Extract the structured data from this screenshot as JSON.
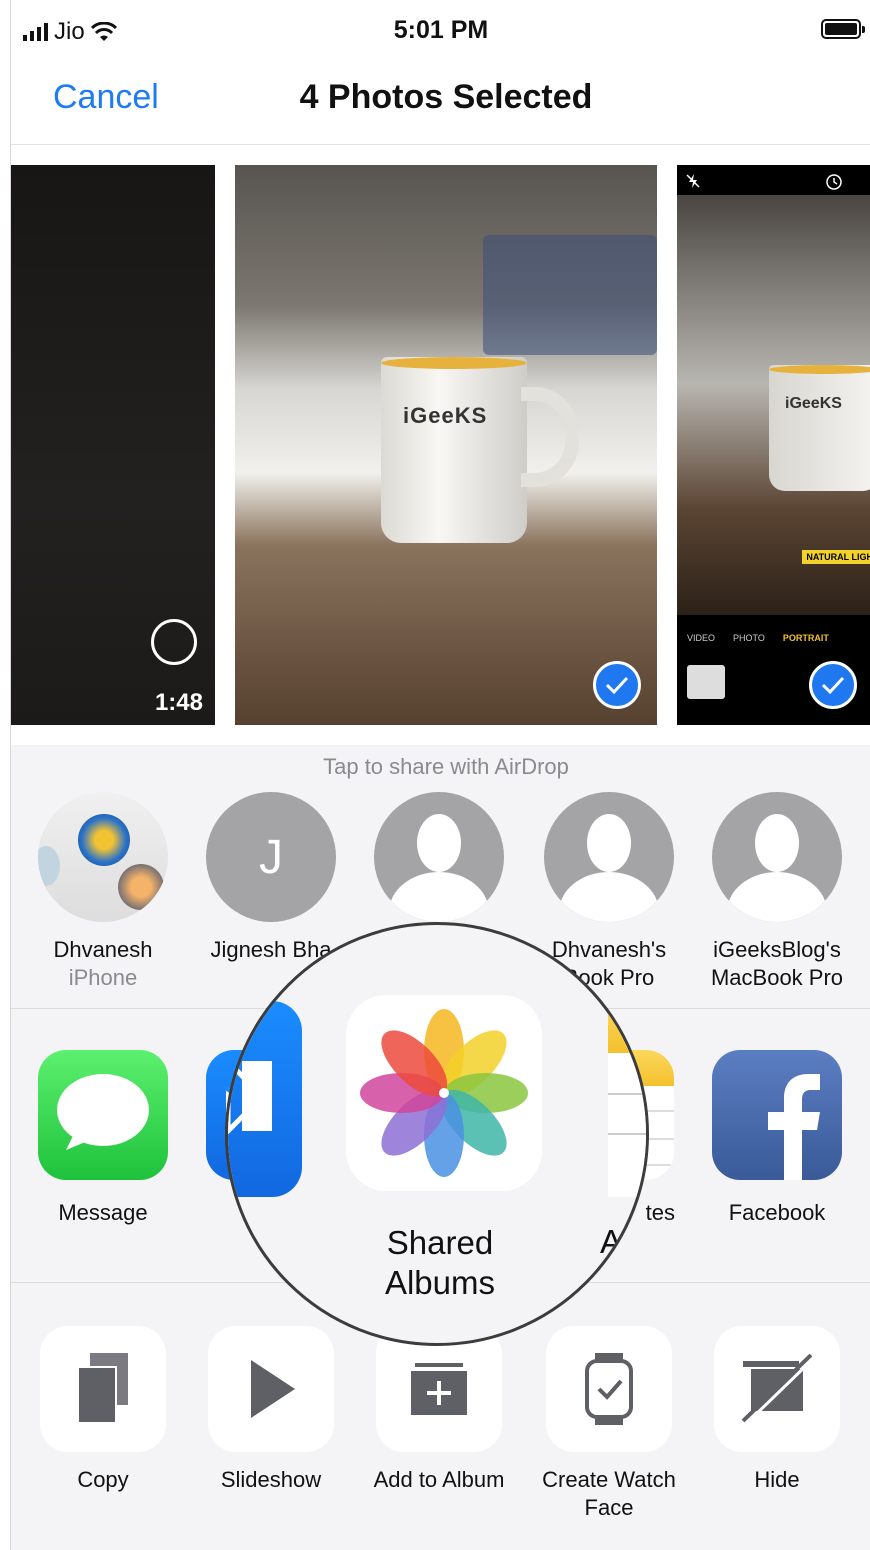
{
  "status": {
    "carrier": "Jio",
    "time": "5:01 PM"
  },
  "nav": {
    "cancel": "Cancel",
    "title": "4 Photos Selected"
  },
  "photos": [
    {
      "duration": "1:48",
      "selected": false
    },
    {
      "mug_text": "iGeeKS",
      "selected": true
    },
    {
      "mug_text": "iGeeKS",
      "banner": "NATURAL LIGH",
      "modes": [
        "VIDEO",
        "PHOTO",
        "PORTRAIT"
      ],
      "selected": true
    }
  ],
  "airdrop": {
    "hint": "Tap to share with AirDrop",
    "contacts": [
      {
        "name": "Dhvanesh",
        "sub": "iPhone"
      },
      {
        "initial": "J",
        "name": "Jignesh Bha"
      },
      {
        "name": "",
        "sub": ""
      },
      {
        "name": "Dhvanesh's",
        "sub": "Book Pro"
      },
      {
        "name": "iGeeksBlog's",
        "sub": "MacBook Pro"
      }
    ]
  },
  "apps": [
    {
      "label": "Message",
      "icon": "message-icon"
    },
    {
      "label": "",
      "icon": "mail-icon"
    },
    {
      "label": "Shared Albums",
      "icon": "photos-icon"
    },
    {
      "label": "tes",
      "icon": "notes-icon"
    },
    {
      "label": "Facebook",
      "icon": "facebook-icon"
    }
  ],
  "magnifier": {
    "label_line1": "Shared",
    "label_line2": "Albums",
    "partial": "Ad"
  },
  "actions": [
    {
      "label": "Copy",
      "icon": "copy-icon"
    },
    {
      "label": "Slideshow",
      "icon": "play-icon"
    },
    {
      "label": "Add to Album",
      "icon": "add-album-icon"
    },
    {
      "label": "Create Watch Face",
      "icon": "watch-icon"
    },
    {
      "label": "Hide",
      "icon": "hide-icon"
    }
  ],
  "colors": {
    "accent": "#1e7cf0",
    "check": "#1f78f0",
    "message_green": "#30c94a",
    "facebook_blue": "#3a5a98"
  }
}
